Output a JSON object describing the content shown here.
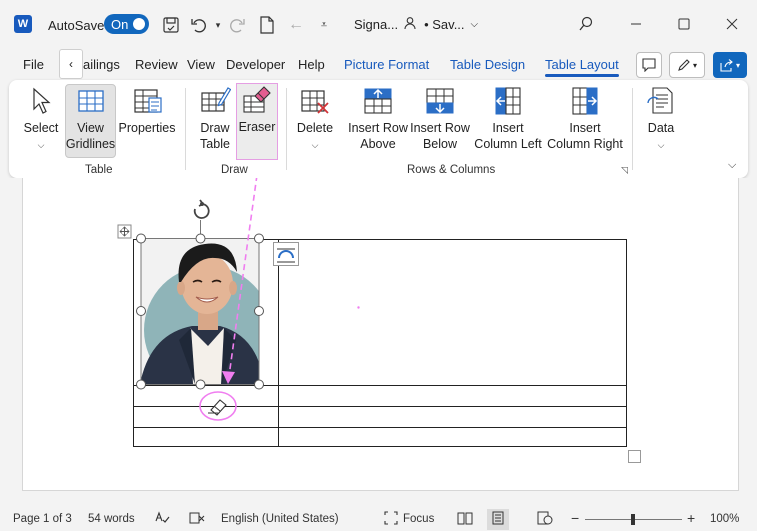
{
  "titlebar": {
    "autosave_label": "AutoSave",
    "toggle_label": "On",
    "doc_name": "Signa...",
    "save_status": "• Sav...",
    "accent": "#185abd",
    "logo_letter": "W"
  },
  "tabs": {
    "file": "File",
    "mailings": "ailings",
    "review": "Review",
    "view": "View",
    "developer": "Developer",
    "help": "Help",
    "picture_format": "Picture Format",
    "table_design": "Table Design",
    "table_layout": "Table Layout"
  },
  "ribbon": {
    "select": "Select",
    "view_gridlines_1": "View",
    "view_gridlines_2": "Gridlines",
    "properties": "Properties",
    "draw_table_1": "Draw",
    "draw_table_2": "Table",
    "eraser": "Eraser",
    "delete": "Delete",
    "insert_row_above_1": "Insert Row",
    "insert_row_above_2": "Above",
    "insert_row_below_1": "Insert Row",
    "insert_row_below_2": "Below",
    "insert_col_left_1": "Insert",
    "insert_col_left_2": "Column Left",
    "insert_col_right_1": "Insert",
    "insert_col_right_2": "Column Right",
    "data": "Data",
    "group_table": "Table",
    "group_draw": "Draw",
    "group_rows_columns": "Rows & Columns"
  },
  "statusbar": {
    "page": "Page 1 of 3",
    "words": "54 words",
    "language": "English (United States)",
    "focus": "Focus",
    "zoom": "100%"
  },
  "colors": {
    "highlight": "#f07ef0",
    "selection": "#185abd"
  }
}
